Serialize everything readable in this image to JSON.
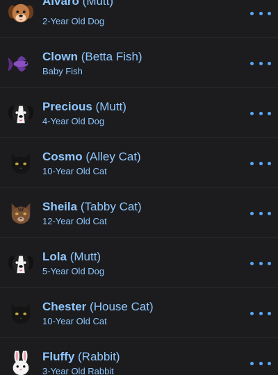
{
  "pets": [
    {
      "name": "Alvaro",
      "breed": "(Mutt)",
      "age": "2-Year Old Dog",
      "icon": "brown-dog-icon"
    },
    {
      "name": "Clown",
      "breed": "(Betta Fish)",
      "age": "Baby Fish",
      "icon": "fish-icon"
    },
    {
      "name": "Precious",
      "breed": "(Mutt)",
      "age": "4-Year Old Dog",
      "icon": "black-white-dog-icon"
    },
    {
      "name": "Cosmo",
      "breed": "(Alley Cat)",
      "age": "10-Year Old Cat",
      "icon": "black-cat-icon"
    },
    {
      "name": "Sheila",
      "breed": "(Tabby Cat)",
      "age": "12-Year Old Cat",
      "icon": "tabby-cat-icon"
    },
    {
      "name": "Lola",
      "breed": "(Mutt)",
      "age": "5-Year Old Dog",
      "icon": "black-white-dog-icon"
    },
    {
      "name": "Chester",
      "breed": "(House Cat)",
      "age": "10-Year Old Cat",
      "icon": "black-cat-icon"
    },
    {
      "name": "Fluffy",
      "breed": "(Rabbit)",
      "age": "3-Year Old Rabbit",
      "icon": "rabbit-icon"
    }
  ],
  "colors": {
    "background": "#1c1c1e",
    "accent": "#8fc7ff",
    "more_dots": "#5aa8f5",
    "divider": "#2c2c2e"
  }
}
